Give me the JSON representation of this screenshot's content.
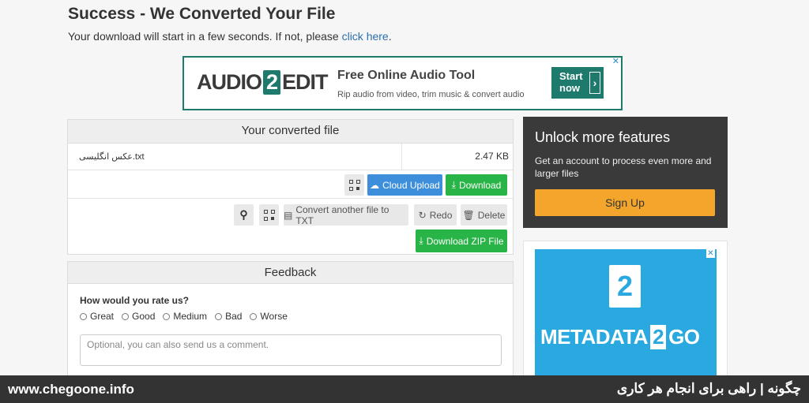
{
  "header": {
    "title": "Success - We Converted Your File",
    "subtitle_text": "Your download will start in a few seconds. If not, please",
    "subtitle_link": "click here",
    "subtitle_end": "."
  },
  "ad_banner": {
    "logo_left": "AUDIO",
    "logo_num": "2",
    "logo_right": "EDIT",
    "headline": "Free Online Audio Tool",
    "sub": "Rip audio from video, trim music & convert audio",
    "cta_line1": "Start",
    "cta_line2": "now",
    "close": "✕"
  },
  "converted": {
    "heading": "Your converted file",
    "file_name": "عکس انگلیسی.txt",
    "file_size": "2.47 KB",
    "buttons": {
      "cloud_upload": "Cloud Upload",
      "download": "Download",
      "convert_another": "Convert another file to TXT",
      "redo": "Redo",
      "delete": "Delete",
      "download_zip": "Download ZIP File"
    }
  },
  "unlock": {
    "title": "Unlock more features",
    "text": "Get an account to process even more and larger files",
    "signup": "Sign Up"
  },
  "ad_side": {
    "num": "2",
    "brand_left": "METADATA",
    "brand_num": "2",
    "brand_right": "GO",
    "close": "✕"
  },
  "feedback": {
    "heading": "Feedback",
    "question": "How would you rate us?",
    "options": [
      "Great",
      "Good",
      "Medium",
      "Bad",
      "Worse"
    ],
    "comment_placeholder": "Optional, you can also send us a comment."
  },
  "footer": {
    "left": "www.chegoone.info",
    "right": "چگونه | راهی برای انجام هر کاری"
  },
  "colors": {
    "accent_green": "#28b446",
    "accent_blue": "#3d8fdc",
    "signup_orange": "#f4a52c",
    "dark_panel": "#3a3a3a"
  }
}
